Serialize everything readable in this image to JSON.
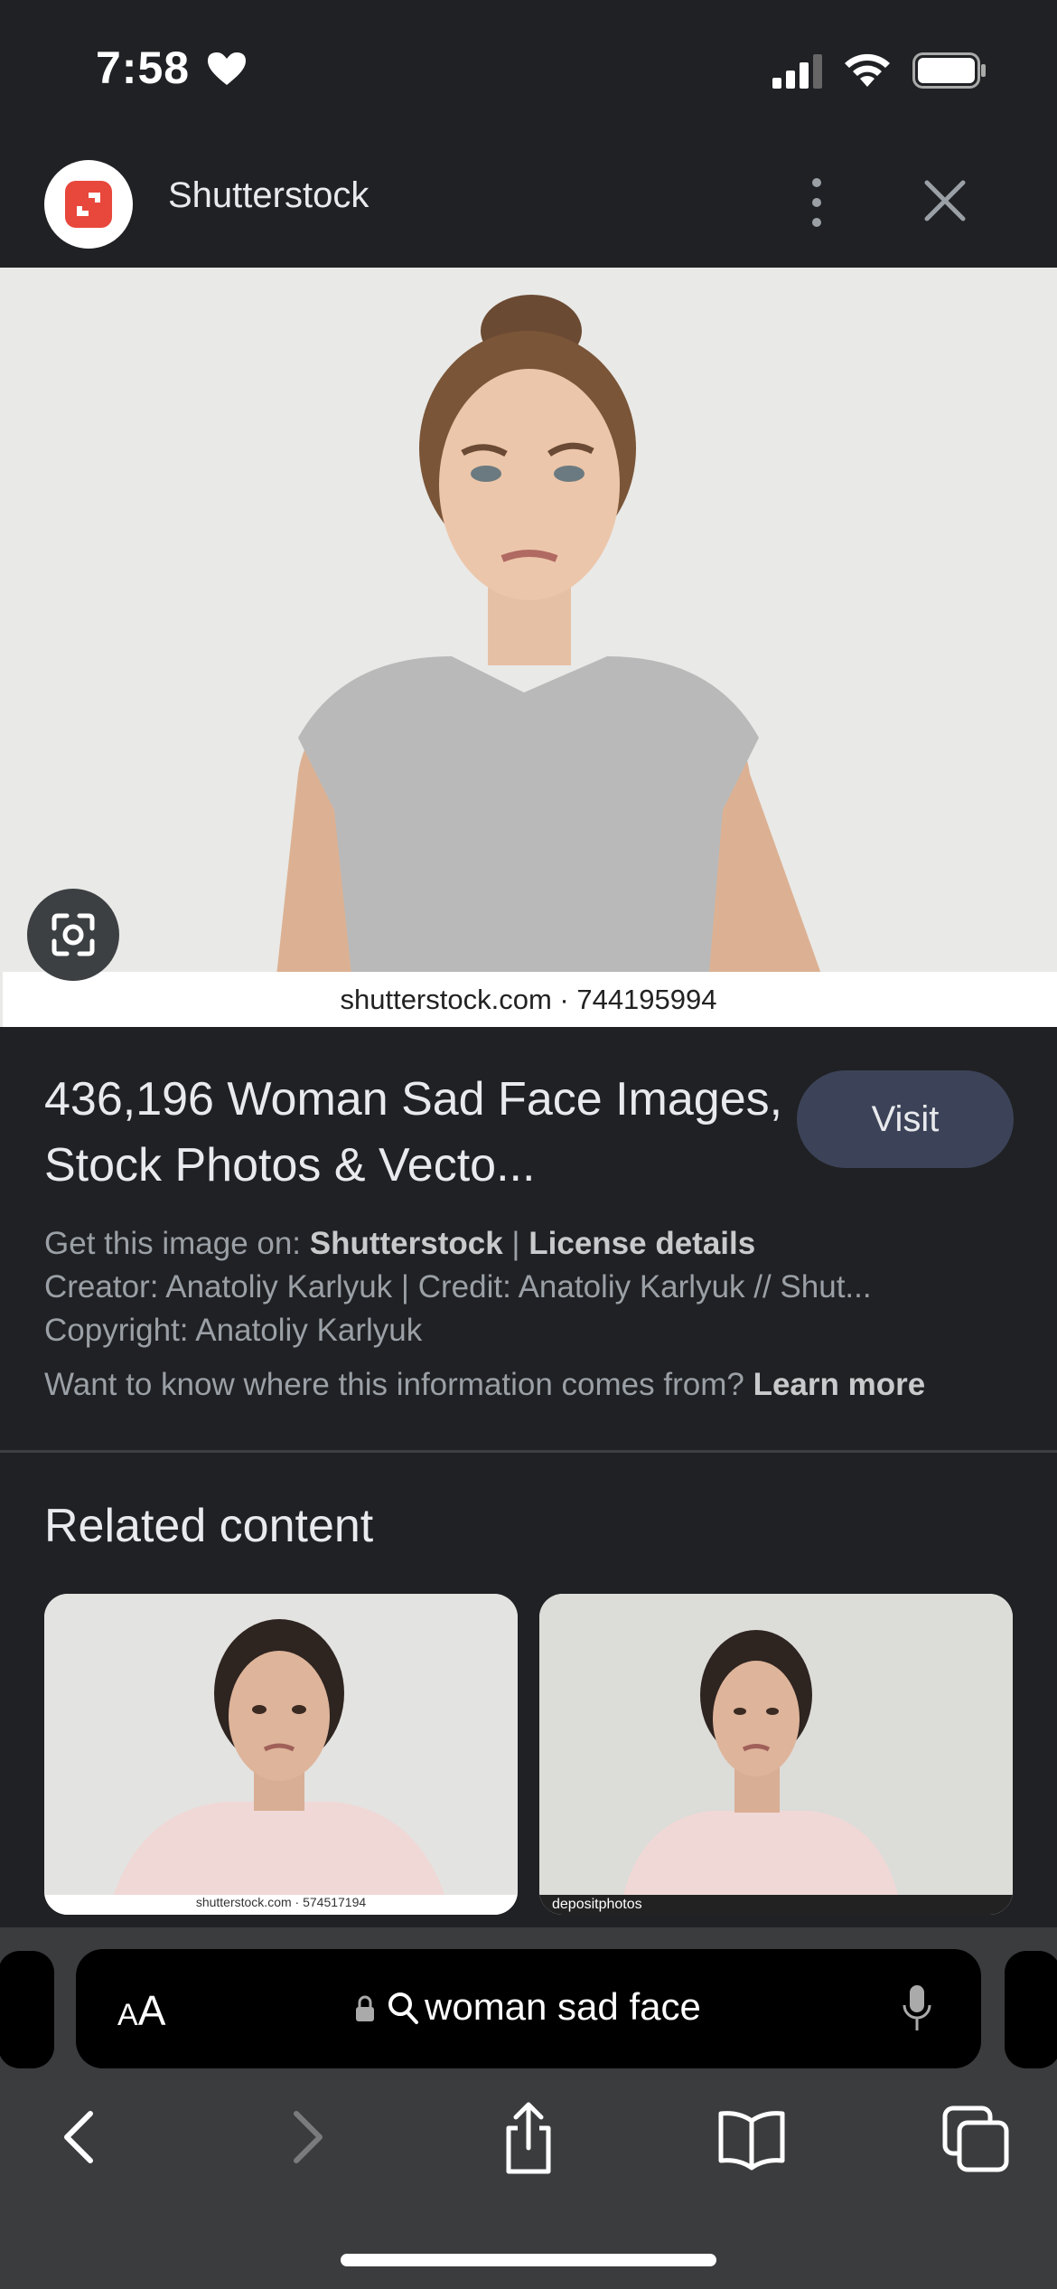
{
  "status_bar": {
    "time": "7:58"
  },
  "header": {
    "site_name": "Shutterstock"
  },
  "hero": {
    "caption": "shutterstock.com · 744195994"
  },
  "result": {
    "title": "436,196 Woman Sad Face Images, Stock Photos & Vecto...",
    "visit_label": "Visit",
    "get_image_prefix": "Get this image on: ",
    "get_image_source": "Shutterstock",
    "separator": " | ",
    "license_label": "License details",
    "creator_line": "Creator: Anatoliy Karlyuk | Credit: Anatoliy Karlyuk // Shut...",
    "copyright_line": "Copyright: Anatoliy Karlyuk",
    "info_question": "Want to know where this information comes from? ",
    "learn_more_label": "Learn more"
  },
  "related": {
    "title": "Related content",
    "items": [
      {
        "watermark": "shutterstock.com · 574517194"
      },
      {
        "watermark": "depositphotos"
      }
    ]
  },
  "browser": {
    "text_size_label_small": "A",
    "text_size_label_large": "A",
    "url_text": "woman sad face"
  },
  "colors": {
    "background": "#202124",
    "visit_button": "#3c4358",
    "brand_red": "#e8473c"
  }
}
